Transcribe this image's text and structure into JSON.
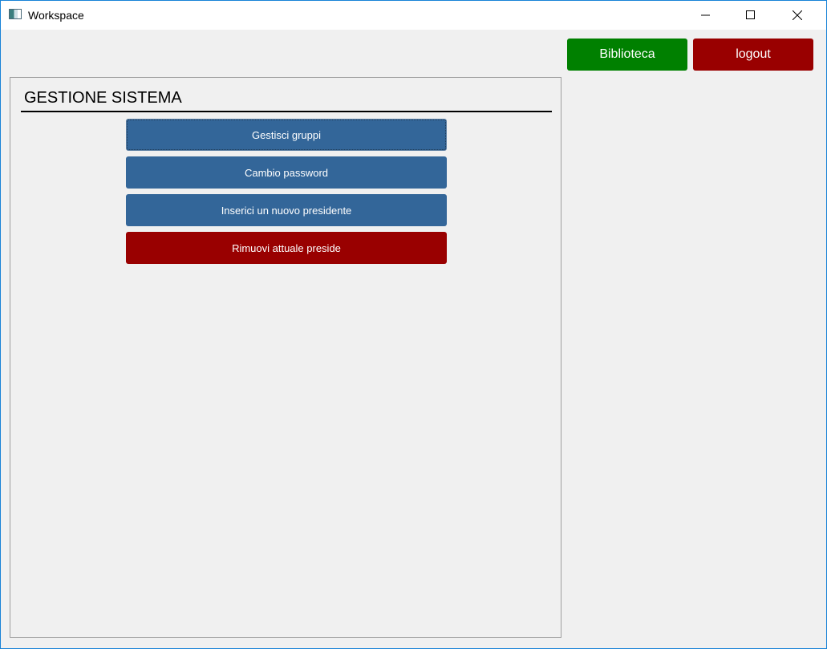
{
  "window": {
    "title": "Workspace",
    "icon": "app-window-icon",
    "controls": [
      "minimize-icon",
      "maximize-icon",
      "close-icon"
    ]
  },
  "header": {
    "biblioteca_label": "Biblioteca",
    "logout_label": "logout",
    "colors": {
      "biblioteca": "#008000",
      "logout": "#990000"
    }
  },
  "panel": {
    "title": "GESTIONE SISTEMA",
    "actions": [
      {
        "label": "Gestisci gruppi",
        "color": "#336699"
      },
      {
        "label": "Cambio password",
        "color": "#336699"
      },
      {
        "label": "Inserici un nuovo presidente",
        "color": "#336699"
      },
      {
        "label": "Rimuovi attuale preside",
        "color": "#990000"
      }
    ]
  }
}
